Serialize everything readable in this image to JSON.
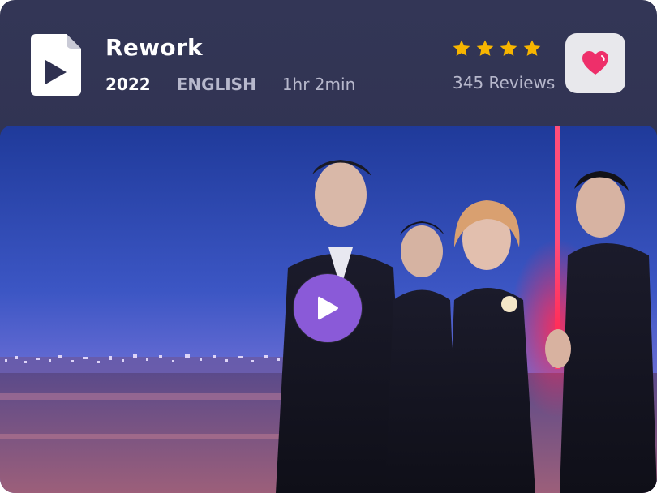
{
  "movie": {
    "title": "Rework",
    "year": "2022",
    "language": "ENGLISH",
    "duration": "1hr 2min"
  },
  "rating": {
    "stars": 4,
    "reviews_label": "345 Reviews"
  },
  "icons": {
    "file": "video-file-icon",
    "favorite": "heart-icon",
    "play": "play-icon",
    "star": "star-icon"
  },
  "colors": {
    "card_bg": "#2f3150",
    "star": "#f7b500",
    "heart": "#ee2f6a",
    "play_button": "#8a5ad8",
    "fav_button_bg": "#e8e8ec"
  }
}
